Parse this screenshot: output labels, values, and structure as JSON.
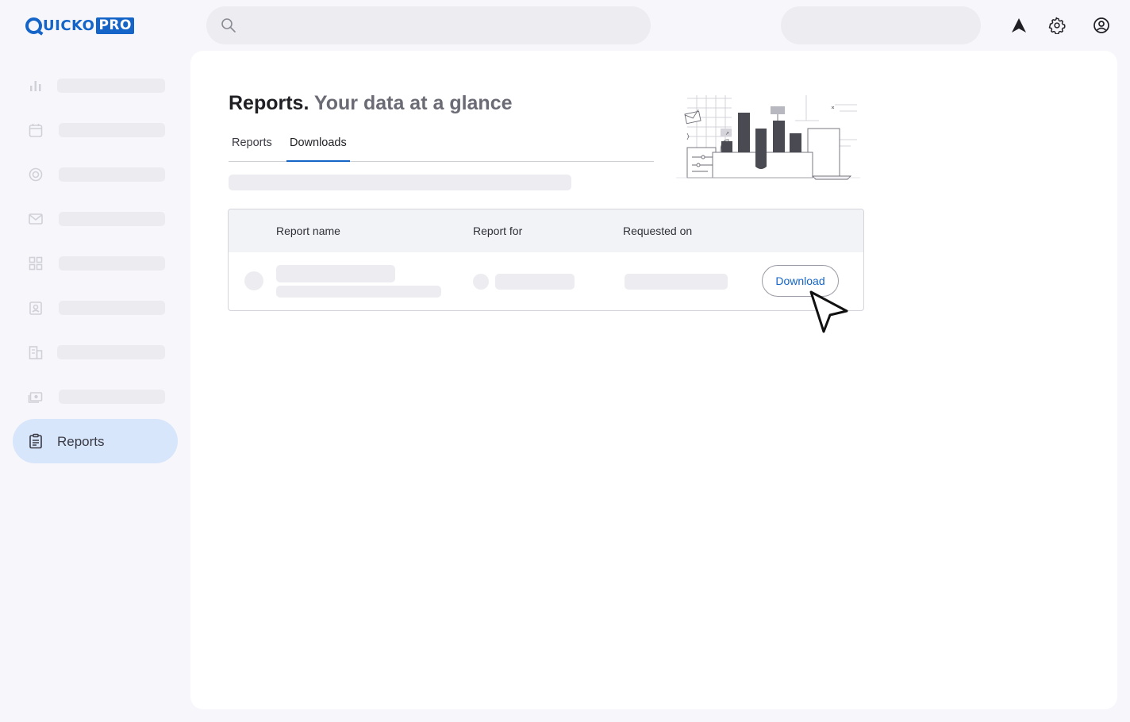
{
  "app": {
    "logo_text": "UICKO",
    "logo_badge": "PRO",
    "brand_color": "#1565c8"
  },
  "topbar": {
    "search_placeholder": "",
    "icons": [
      "navigate-icon",
      "gear-icon",
      "user-circle-icon"
    ]
  },
  "sidebar": {
    "items": [
      {
        "icon": "bar-chart-icon",
        "label": ""
      },
      {
        "icon": "calendar-icon",
        "label": ""
      },
      {
        "icon": "target-icon",
        "label": ""
      },
      {
        "icon": "mail-icon",
        "label": ""
      },
      {
        "icon": "grid-icon",
        "label": ""
      },
      {
        "icon": "id-card-icon",
        "label": ""
      },
      {
        "icon": "building-icon",
        "label": ""
      },
      {
        "icon": "cash-icon",
        "label": ""
      },
      {
        "icon": "clipboard-icon",
        "label": "Reports",
        "active": true
      }
    ]
  },
  "main": {
    "title_strong": "Reports.",
    "title_light": "Your data at a glance",
    "tabs": [
      {
        "label": "Reports",
        "active": false
      },
      {
        "label": "Downloads",
        "active": true
      }
    ]
  },
  "table": {
    "columns": [
      "Report name",
      "Report for",
      "Requested on"
    ],
    "rows": [
      {
        "action_label": "Download"
      }
    ]
  },
  "colors": {
    "active_nav_bg": "#d7e6fb",
    "skeleton": "#ececf1",
    "accent": "#1565c8"
  }
}
